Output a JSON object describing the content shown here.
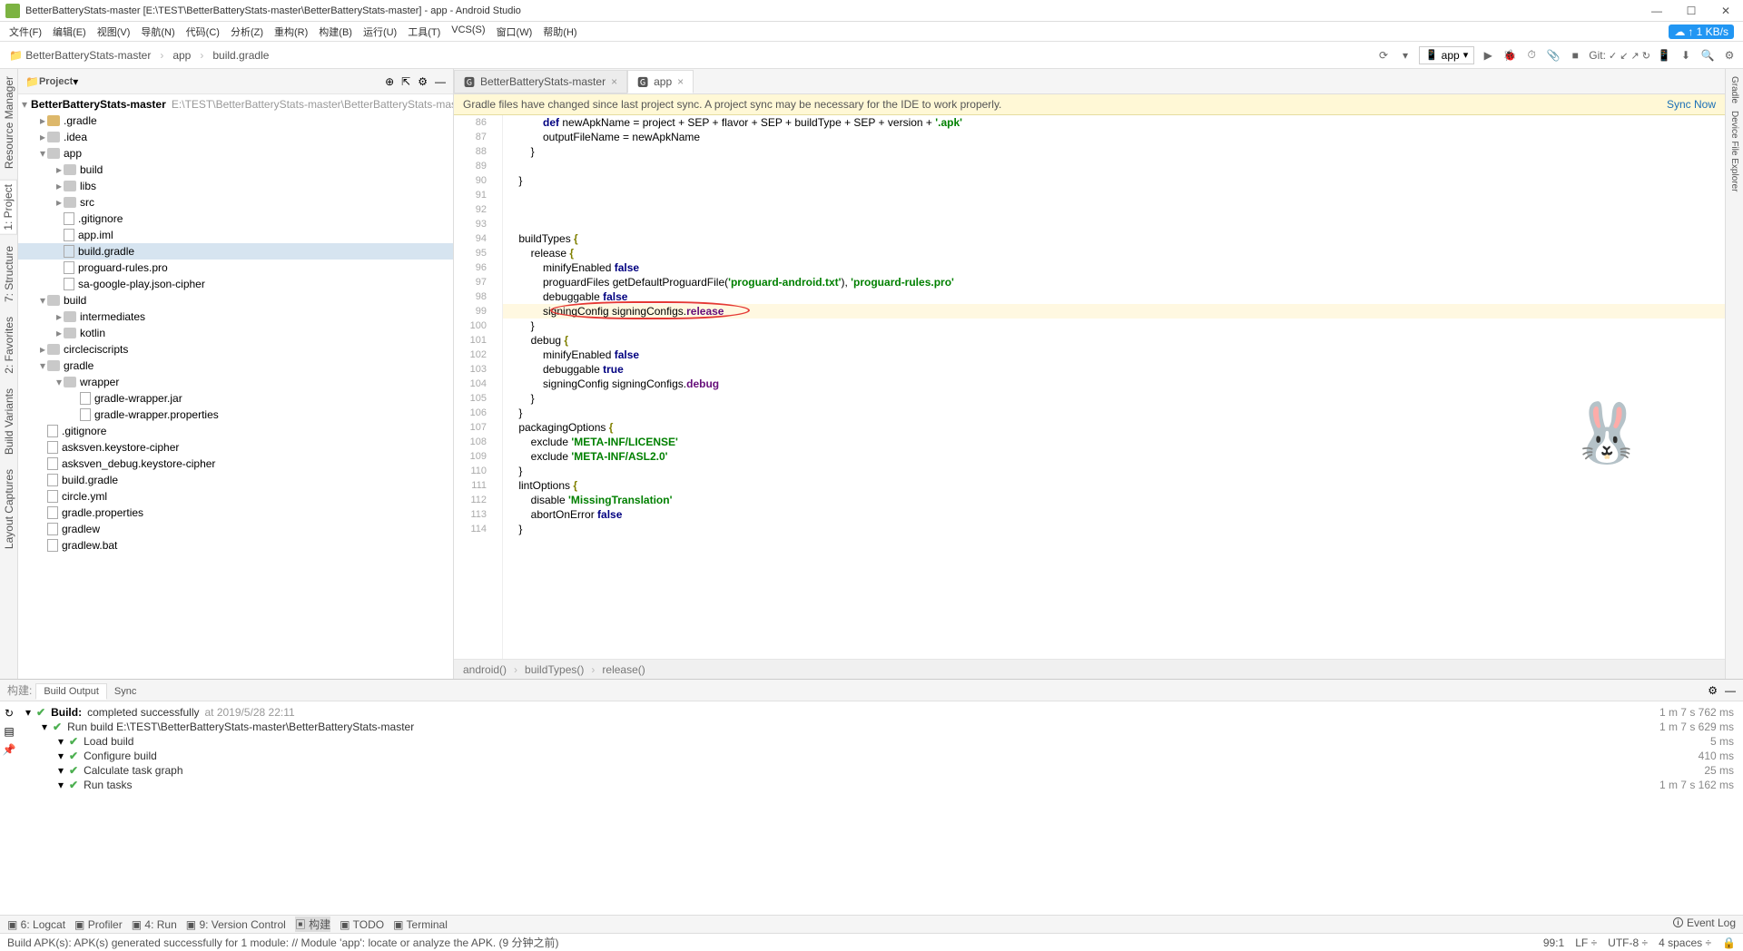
{
  "title": "BetterBatteryStats-master [E:\\TEST\\BetterBatteryStats-master\\BetterBatteryStats-master] - app - Android Studio",
  "speed_badge": "↑ 1 KB/s",
  "menu": [
    "文件(F)",
    "编辑(E)",
    "视图(V)",
    "导航(N)",
    "代码(C)",
    "分析(Z)",
    "重构(R)",
    "构建(B)",
    "运行(U)",
    "工具(T)",
    "VCS(S)",
    "窗口(W)",
    "帮助(H)"
  ],
  "breadcrumb": [
    "BetterBatteryStats-master",
    "app",
    "build.gradle"
  ],
  "run_config": "app",
  "git_label": "Git:",
  "panel_header": "Project",
  "project_root": "BetterBatteryStats-master",
  "project_root_path": "E:\\TEST\\BetterBatteryStats-master\\BetterBatteryStats-master",
  "tree": [
    {
      "d": 1,
      "t": ".gradle",
      "exp": "▸",
      "ic": "folder-y"
    },
    {
      "d": 1,
      "t": ".idea",
      "exp": "▸",
      "ic": "folder-g"
    },
    {
      "d": 1,
      "t": "app",
      "exp": "▾",
      "ic": "folder-g"
    },
    {
      "d": 2,
      "t": "build",
      "exp": "▸",
      "ic": "folder-g"
    },
    {
      "d": 2,
      "t": "libs",
      "exp": "▸",
      "ic": "folder-g"
    },
    {
      "d": 2,
      "t": "src",
      "exp": "▸",
      "ic": "folder-g"
    },
    {
      "d": 2,
      "t": ".gitignore",
      "exp": "",
      "ic": "file"
    },
    {
      "d": 2,
      "t": "app.iml",
      "exp": "",
      "ic": "file"
    },
    {
      "d": 2,
      "t": "build.gradle",
      "exp": "",
      "ic": "file",
      "sel": true
    },
    {
      "d": 2,
      "t": "proguard-rules.pro",
      "exp": "",
      "ic": "file"
    },
    {
      "d": 2,
      "t": "sa-google-play.json-cipher",
      "exp": "",
      "ic": "file"
    },
    {
      "d": 1,
      "t": "build",
      "exp": "▾",
      "ic": "folder-g"
    },
    {
      "d": 2,
      "t": "intermediates",
      "exp": "▸",
      "ic": "folder-g"
    },
    {
      "d": 2,
      "t": "kotlin",
      "exp": "▸",
      "ic": "folder-g"
    },
    {
      "d": 1,
      "t": "circleciscripts",
      "exp": "▸",
      "ic": "folder-g"
    },
    {
      "d": 1,
      "t": "gradle",
      "exp": "▾",
      "ic": "folder-g"
    },
    {
      "d": 2,
      "t": "wrapper",
      "exp": "▾",
      "ic": "folder-g"
    },
    {
      "d": 3,
      "t": "gradle-wrapper.jar",
      "exp": "",
      "ic": "file"
    },
    {
      "d": 3,
      "t": "gradle-wrapper.properties",
      "exp": "",
      "ic": "file"
    },
    {
      "d": 1,
      "t": ".gitignore",
      "exp": "",
      "ic": "file"
    },
    {
      "d": 1,
      "t": "asksven.keystore-cipher",
      "exp": "",
      "ic": "file"
    },
    {
      "d": 1,
      "t": "asksven_debug.keystore-cipher",
      "exp": "",
      "ic": "file"
    },
    {
      "d": 1,
      "t": "build.gradle",
      "exp": "",
      "ic": "file"
    },
    {
      "d": 1,
      "t": "circle.yml",
      "exp": "",
      "ic": "file"
    },
    {
      "d": 1,
      "t": "gradle.properties",
      "exp": "",
      "ic": "file"
    },
    {
      "d": 1,
      "t": "gradlew",
      "exp": "",
      "ic": "file"
    },
    {
      "d": 1,
      "t": "gradlew.bat",
      "exp": "",
      "ic": "file"
    }
  ],
  "editor_tabs": [
    {
      "label": "BetterBatteryStats-master",
      "active": false
    },
    {
      "label": "app",
      "active": true
    }
  ],
  "notification": "Gradle files have changed since last project sync. A project sync may be necessary for the IDE to work properly.",
  "sync_label": "Sync Now",
  "code": {
    "start": 86,
    "lines": [
      {
        "n": 86,
        "h": "            <span class='kw-blue'>def</span> newApkName = project + SEP + flavor + SEP + buildType + SEP + version + <span class='str'>'.apk'</span>"
      },
      {
        "n": 87,
        "h": "            outputFileName = newApkName"
      },
      {
        "n": 88,
        "h": "        }"
      },
      {
        "n": 89,
        "h": ""
      },
      {
        "n": 90,
        "h": "    }"
      },
      {
        "n": 91,
        "h": ""
      },
      {
        "n": 92,
        "h": ""
      },
      {
        "n": 93,
        "h": ""
      },
      {
        "n": 94,
        "h": "    buildTypes <span class='kw-olive'>{</span>"
      },
      {
        "n": 95,
        "h": "        release <span class='kw-olive'>{</span>"
      },
      {
        "n": 96,
        "h": "            minifyEnabled <span class='kw-blue'>false</span>"
      },
      {
        "n": 97,
        "h": "            proguardFiles getDefaultProguardFile(<span class='str'>'proguard-android.txt'</span>), <span class='str'>'proguard-rules.pro'</span>"
      },
      {
        "n": 98,
        "h": "            debuggable <span class='kw-blue'>false</span>"
      },
      {
        "n": 99,
        "h": "            signingConfig signingConfigs.<span class='kw-purple'>release</span>",
        "hl": true,
        "ellipse": true
      },
      {
        "n": 100,
        "h": "        }"
      },
      {
        "n": 101,
        "h": "        debug <span class='kw-olive'>{</span>"
      },
      {
        "n": 102,
        "h": "            minifyEnabled <span class='kw-blue'>false</span>"
      },
      {
        "n": 103,
        "h": "            debuggable <span class='kw-blue'>true</span>"
      },
      {
        "n": 104,
        "h": "            signingConfig signingConfigs.<span class='kw-purple'>debug</span>"
      },
      {
        "n": 105,
        "h": "        }"
      },
      {
        "n": 106,
        "h": "    }"
      },
      {
        "n": 107,
        "h": "    packagingOptions <span class='kw-olive'>{</span>"
      },
      {
        "n": 108,
        "h": "        exclude <span class='str'>'META-INF/LICENSE'</span>"
      },
      {
        "n": 109,
        "h": "        exclude <span class='str'>'META-INF/ASL2.0'</span>"
      },
      {
        "n": 110,
        "h": "    }"
      },
      {
        "n": 111,
        "h": "    lintOptions <span class='kw-olive'>{</span>"
      },
      {
        "n": 112,
        "h": "        disable <span class='str'>'MissingTranslation'</span>"
      },
      {
        "n": 113,
        "h": "        abortOnError <span class='kw-blue'>false</span>"
      },
      {
        "n": 114,
        "h": "    }"
      }
    ]
  },
  "breadcrumb2": [
    "android()",
    "buildTypes()",
    "release()"
  ],
  "build_panel": {
    "tabs_left": "构建:",
    "tabs": [
      "Build Output",
      "Sync"
    ],
    "tabs_active": 0,
    "rows": [
      {
        "d": 0,
        "chk": true,
        "bold": "Build:",
        "t": "completed successfully",
        "extra": "at 2019/5/28 22:11",
        "tm": "1 m 7 s 762 ms"
      },
      {
        "d": 1,
        "chk": true,
        "t": "Run build E:\\TEST\\BetterBatteryStats-master\\BetterBatteryStats-master",
        "tm": "1 m 7 s 629 ms"
      },
      {
        "d": 2,
        "chk": true,
        "t": "Load build",
        "tm": "5 ms"
      },
      {
        "d": 2,
        "chk": true,
        "t": "Configure build",
        "tm": "410 ms"
      },
      {
        "d": 2,
        "chk": true,
        "t": "Calculate task graph",
        "tm": "25 ms"
      },
      {
        "d": 2,
        "chk": true,
        "t": "Run tasks",
        "tm": "1 m 7 s 162 ms"
      }
    ]
  },
  "bottom_bar": [
    {
      "n": "6: Logcat"
    },
    {
      "n": "Profiler"
    },
    {
      "n": "4: Run"
    },
    {
      "n": "9: Version Control"
    },
    {
      "n": "构建",
      "act": true
    },
    {
      "n": "TODO"
    },
    {
      "n": "Terminal"
    }
  ],
  "event_log": "Event Log",
  "status_msg": "Build APK(s): APK(s) generated successfully for 1 module: // Module 'app': locate or analyze the APK. (9 分钟之前)",
  "status_right": [
    "99:1",
    "LF ÷",
    "UTF-8 ÷",
    "4 spaces ÷"
  ],
  "left_tabs": [
    "Resource Manager",
    "1: Project",
    "7: Structure",
    "2: Favorites",
    "Build Variants",
    "Layout Captures"
  ],
  "right_tabs": [
    "Gradle",
    "Device File Explorer"
  ]
}
